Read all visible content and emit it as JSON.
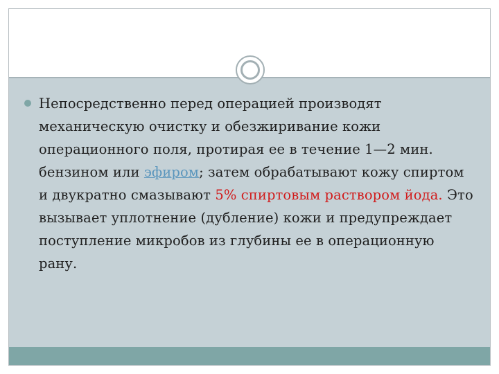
{
  "slide": {
    "text_part1": "Непосредственно перед операцией производят механическую очистку и обезжиривание кожи операционного поля, протирая ее в течение 1—2 мин. бензином или ",
    "link": "эфиром",
    "text_part2": "; затем обрабатывают кожу спиртом и двукратно смазывают ",
    "highlight": "5% спиртовым раствором йода.",
    "text_part3": " Это вызывает уплотнение (дубление) кожи и предупреждает поступление микробов из глубины ее в операционную рану."
  },
  "colors": {
    "content_background": "#c5d1d6",
    "accent_teal": "#7fa6a6",
    "link_blue": "#5b96bd",
    "highlight_red": "#d11c1c",
    "text": "#1f1f1f"
  },
  "icons": {
    "bullet": "bullet-dot-icon",
    "divider_ornament": "ring-ornament-icon"
  }
}
